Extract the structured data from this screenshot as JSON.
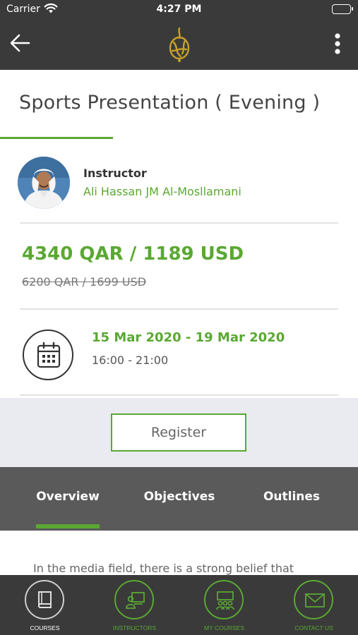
{
  "status_bar": {
    "carrier": "Carrier",
    "time": "4:27 PM"
  },
  "nav": {
    "back_icon": "arrow-left-icon",
    "logo_icon": "aljazeera-logo",
    "menu_icon": "more-vertical-icon"
  },
  "course": {
    "title": "Sports Presentation ( Evening )"
  },
  "instructor": {
    "label": "Instructor",
    "name": "Ali Hassan JM Al-Mosllamani"
  },
  "pricing": {
    "price": "4340 QAR / 1189 USD",
    "old_price": "6200 QAR / 1699 USD"
  },
  "schedule": {
    "dates": "15 Mar 2020 - 19 Mar 2020",
    "hours": "16:00 - 21:00",
    "icon": "calendar-icon"
  },
  "register": {
    "label": "Register"
  },
  "tabs": [
    {
      "label": "Overview",
      "active": true
    },
    {
      "label": "Objectives",
      "active": false
    },
    {
      "label": "Outlines",
      "active": false
    }
  ],
  "overview": {
    "text": "In the media field, there is a strong belief that"
  },
  "bottom_nav": [
    {
      "label": "COURSES",
      "icon": "book-icon",
      "active": true
    },
    {
      "label": "INSTRUCTORS",
      "icon": "presenter-icon",
      "active": false
    },
    {
      "label": "MY COURSES",
      "icon": "classroom-icon",
      "active": false
    },
    {
      "label": "CONTACT US",
      "icon": "mail-icon",
      "active": false
    }
  ],
  "colors": {
    "accent": "#5aa832",
    "header_bg": "#3a3a3a",
    "tabs_bg": "#5a5a5a",
    "logo": "#c9a227"
  }
}
